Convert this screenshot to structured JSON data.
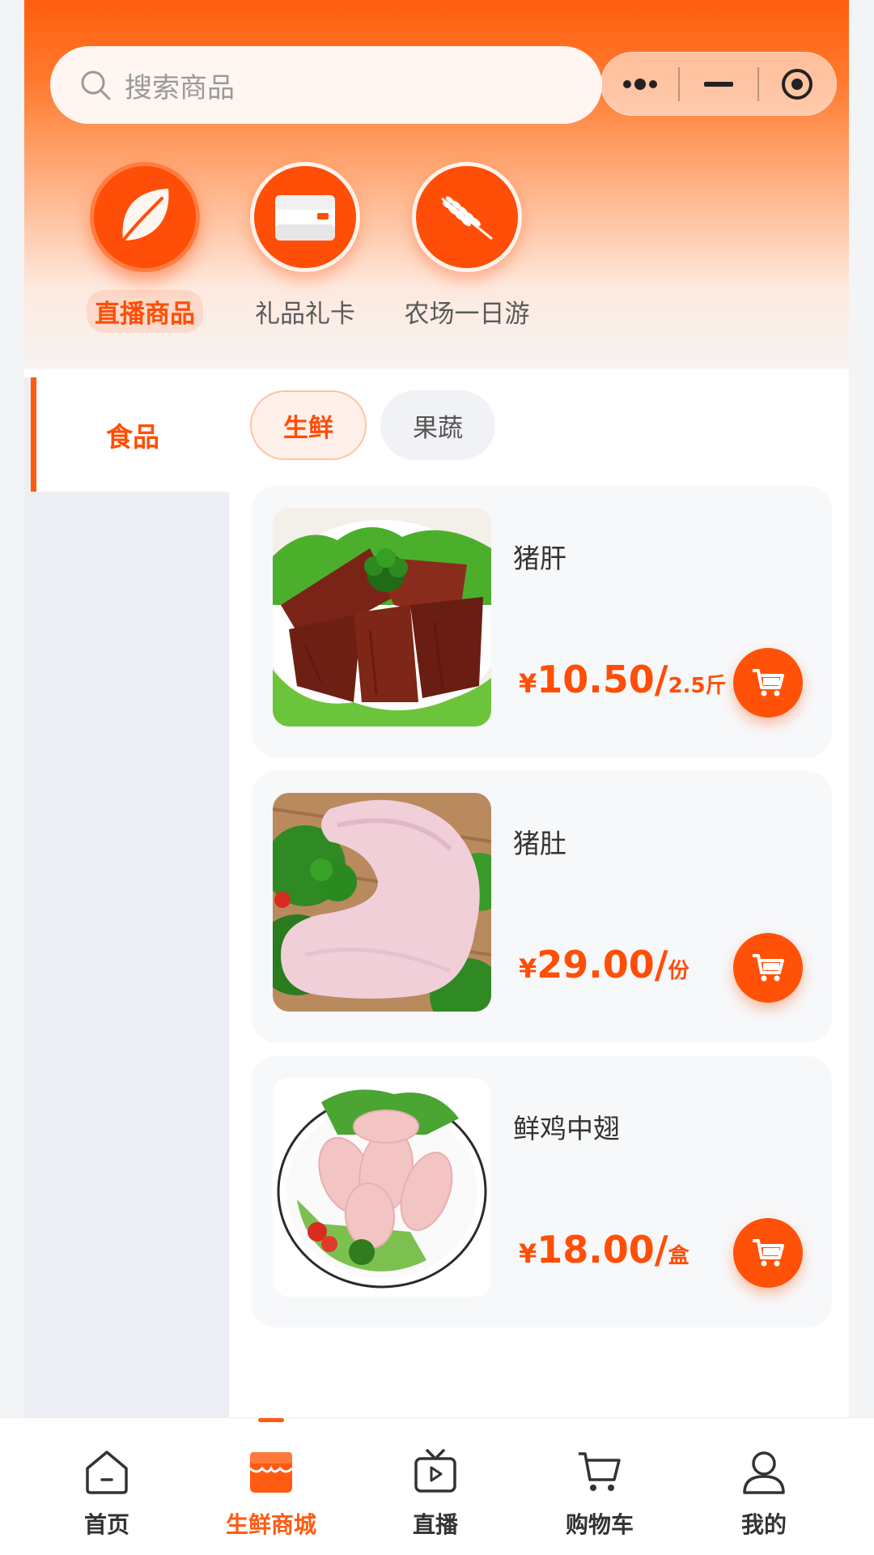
{
  "search": {
    "placeholder": "搜索商品"
  },
  "capsule": {
    "icons": [
      "more-dots-icon",
      "minimize-icon",
      "target-icon"
    ]
  },
  "categories": [
    {
      "label": "直播商品",
      "icon": "leaf-icon",
      "active": true
    },
    {
      "label": "礼品礼卡",
      "icon": "card-icon",
      "active": false
    },
    {
      "label": "农场一日游",
      "icon": "wheat-icon",
      "active": false
    }
  ],
  "sidebar": {
    "items": [
      {
        "label": "食品",
        "active": true
      }
    ]
  },
  "subtabs": [
    {
      "label": "生鲜",
      "active": true
    },
    {
      "label": "果蔬",
      "active": false
    }
  ],
  "products": [
    {
      "name": "猪肝",
      "currency": "¥",
      "price": "10.50",
      "slash": "/",
      "unit": "2.5斤",
      "image": "pork-liver-photo"
    },
    {
      "name": "猪肚",
      "currency": "¥",
      "price": "29.00",
      "slash": "/",
      "unit": "份",
      "image": "pork-tripe-photo"
    },
    {
      "name": "鲜鸡中翅",
      "currency": "¥",
      "price": "18.00",
      "slash": "/",
      "unit": "盒",
      "image": "chicken-wings-photo"
    }
  ],
  "tabbar": {
    "items": [
      {
        "label": "首页",
        "icon": "home-icon",
        "active": false
      },
      {
        "label": "生鲜商城",
        "icon": "store-icon",
        "active": true
      },
      {
        "label": "直播",
        "icon": "tv-icon",
        "active": false
      },
      {
        "label": "购物车",
        "icon": "cart-icon",
        "active": false
      },
      {
        "label": "我的",
        "icon": "user-icon",
        "active": false
      }
    ]
  },
  "colors": {
    "accent": "#ff5208",
    "header_top": "#ff5e0e",
    "sidebar_bg": "#eceef3",
    "card_bg": "#f7f8fa"
  }
}
